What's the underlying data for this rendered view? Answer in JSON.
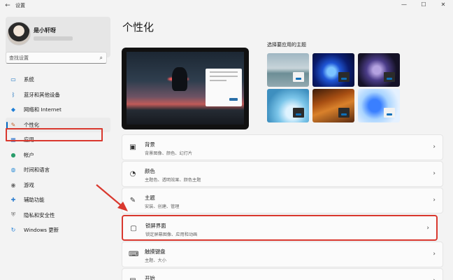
{
  "window": {
    "back_glyph": "←",
    "title": "设置",
    "controls": [
      "—",
      "☐",
      "✕"
    ]
  },
  "profile": {
    "name": "是小轩呀"
  },
  "search": {
    "placeholder": "查找设置",
    "icon": "search-icon"
  },
  "nav": {
    "items": [
      {
        "label": "系统",
        "icon": "monitor-icon",
        "glyph": "▭",
        "color": "#0f6cbd"
      },
      {
        "label": "蓝牙和其他设备",
        "icon": "bluetooth-icon",
        "glyph": "ᛒ",
        "color": "#0f6cbd"
      },
      {
        "label": "网络和 Internet",
        "icon": "wifi-icon",
        "glyph": "◆",
        "color": "#1f7ed6"
      },
      {
        "label": "个性化",
        "icon": "brush-icon",
        "glyph": "✎",
        "color": "#c4622d"
      },
      {
        "label": "应用",
        "icon": "apps-icon",
        "glyph": "▦",
        "color": "#3b7fd0"
      },
      {
        "label": "帐户",
        "icon": "account-icon",
        "glyph": "●",
        "color": "#2a9d6b"
      },
      {
        "label": "时间和语言",
        "icon": "globe-icon",
        "glyph": "◍",
        "color": "#2f8fd6"
      },
      {
        "label": "游戏",
        "icon": "gamepad-icon",
        "glyph": "◉",
        "color": "#6b6b6b"
      },
      {
        "label": "辅助功能",
        "icon": "accessibility-icon",
        "glyph": "✚",
        "color": "#2f7fd0"
      },
      {
        "label": "隐私和安全性",
        "icon": "shield-icon",
        "glyph": "⛨",
        "color": "#6b6b6b"
      },
      {
        "label": "Windows 更新",
        "icon": "update-icon",
        "glyph": "↻",
        "color": "#1f7ed6"
      }
    ],
    "active_index": 3
  },
  "main": {
    "title": "个性化",
    "themes_label": "选择要应用的主题",
    "cards": [
      {
        "title": "背景",
        "subtitle": "背景图像、颜色、幻灯片",
        "icon": "image-icon",
        "glyph": "▣"
      },
      {
        "title": "颜色",
        "subtitle": "主题色、透明效果、颜色主题",
        "icon": "palette-icon",
        "glyph": "◔"
      },
      {
        "title": "主题",
        "subtitle": "安装、创建、管理",
        "icon": "theme-brush-icon",
        "glyph": "✎"
      },
      {
        "title": "锁屏界面",
        "subtitle": "锁定屏幕图像、应用和动画",
        "icon": "lock-screen-icon",
        "glyph": "▢"
      },
      {
        "title": "触摸键盘",
        "subtitle": "主题、大小",
        "icon": "keyboard-icon",
        "glyph": "⌨"
      },
      {
        "title": "开始",
        "subtitle": "",
        "icon": "start-icon",
        "glyph": "▤"
      }
    ],
    "chevron": "›"
  },
  "colors": {
    "accent": "#0067c0",
    "highlight_red": "#d9382e"
  }
}
